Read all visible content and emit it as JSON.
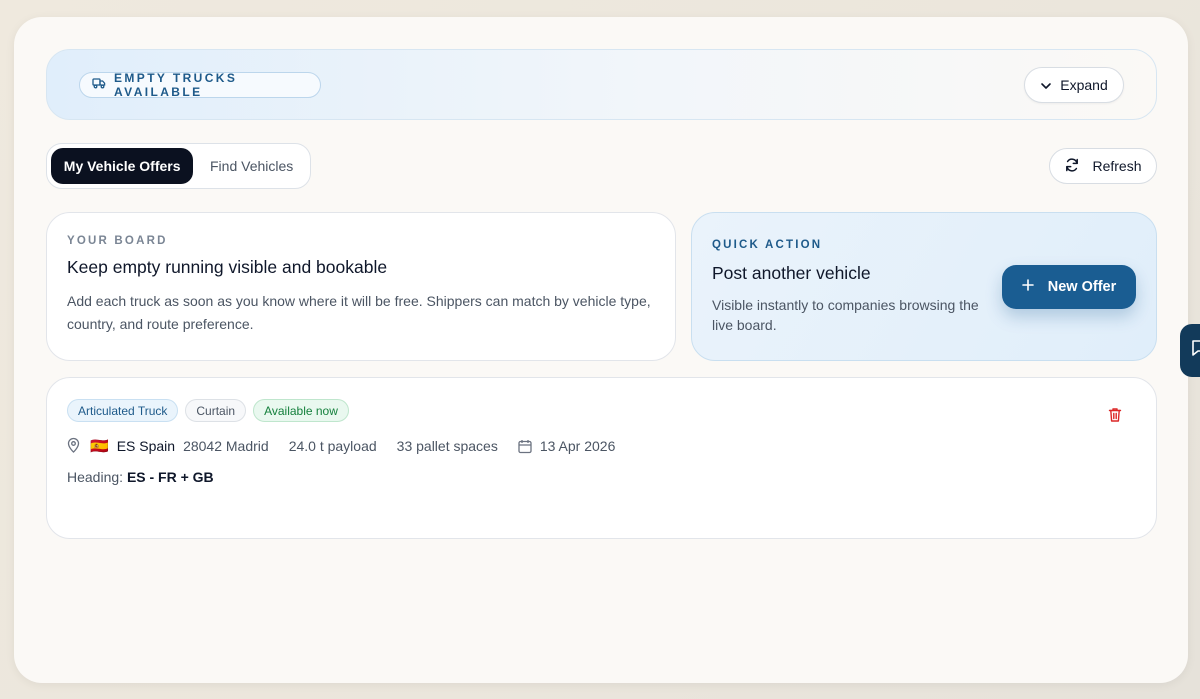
{
  "hero": {
    "badge": "EMPTY TRUCKS AVAILABLE",
    "expand_label": "Expand"
  },
  "tabs": [
    {
      "label": "My Vehicle Offers",
      "active": true
    },
    {
      "label": "Find Vehicles",
      "active": false
    }
  ],
  "refresh_label": "Refresh",
  "board": {
    "eyebrow": "YOUR BOARD",
    "title": "Keep empty running visible and bookable",
    "body": "Add each truck as soon as you know where it will be free. Shippers can match by vehicle type, country, and route preference."
  },
  "quick_action": {
    "eyebrow": "QUICK ACTION",
    "title": "Post another vehicle",
    "body": "Visible instantly to companies browsing the live board.",
    "button_label": "New Offer"
  },
  "offer": {
    "tags": [
      "Articulated Truck",
      "Curtain",
      "Available now"
    ],
    "flag": "🇪🇸",
    "country": "ES Spain",
    "postal": "28042 Madrid",
    "payload": "24.0 t payload",
    "pallets": "33 pallet spaces",
    "date": "13 Apr 2026",
    "heading_label": "Heading:",
    "heading_value": "ES - FR + GB"
  },
  "colors": {
    "accent": "#1a5d92",
    "dark": "#0b1120",
    "available_green": "#15803d",
    "delete_red": "#dc2626"
  },
  "icons": [
    "truck-icon",
    "chevron-down-icon",
    "refresh-icon",
    "plus-icon",
    "trash-icon",
    "location-pin-icon",
    "calendar-icon",
    "chat-icon"
  ]
}
